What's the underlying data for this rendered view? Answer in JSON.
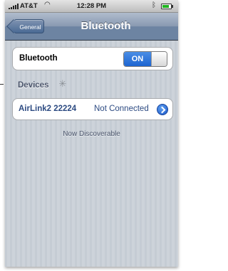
{
  "status_bar": {
    "carrier": "AT&T",
    "wifi_icon": "wifi-icon",
    "time": "12:28 PM",
    "bluetooth_icon": "bluetooth-icon",
    "battery_icon": "battery-icon"
  },
  "nav": {
    "back_label": "General",
    "title": "Bluetooth"
  },
  "bluetooth_setting": {
    "label": "Bluetooth",
    "switch_label": "ON",
    "enabled": true
  },
  "devices": {
    "header": "Devices",
    "items": [
      {
        "name": "AirLink2 22224",
        "status": "Not Connected"
      }
    ]
  },
  "footer_text": "Now Discoverable",
  "colors": {
    "nav_bar": "#6d84a2",
    "switch_on": "#1d64d0",
    "device_text": "#2d4b82",
    "background": "#c5ccd4"
  }
}
